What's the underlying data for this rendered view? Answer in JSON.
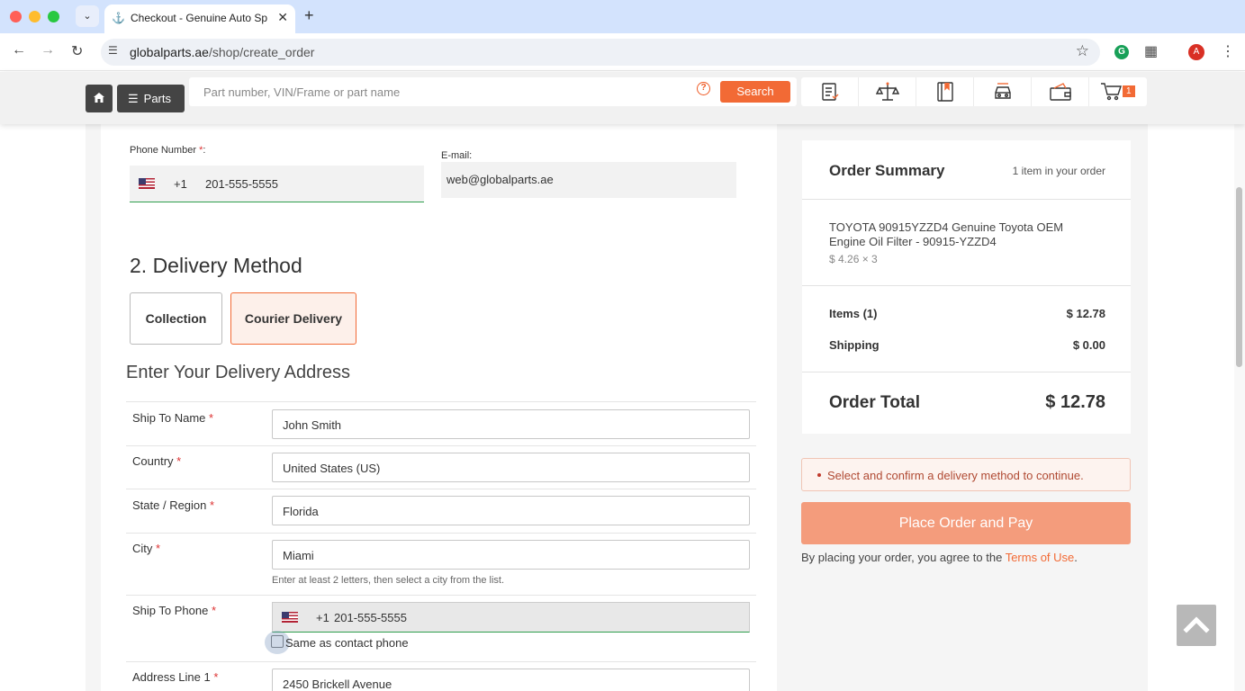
{
  "browser": {
    "tab_title": "Checkout - Genuine Auto Spa",
    "url_host": "globalparts.ae",
    "url_path": "/shop/create_order",
    "avatar_letter": "A"
  },
  "header": {
    "parts_label": "Parts",
    "search_placeholder": "Part number, VIN/Frame or part name",
    "search_button": "Search",
    "cart_count": "1"
  },
  "contact": {
    "phone_label": "Phone Number",
    "phone_code": "+1",
    "phone_value": "201-555-5555",
    "email_label": "E-mail:",
    "email_value": "web@globalparts.ae"
  },
  "delivery": {
    "title": "2. Delivery Method",
    "option_collection": "Collection",
    "option_courier": "Courier Delivery",
    "selected": "Courier Delivery"
  },
  "address": {
    "title": "Enter Your Delivery Address",
    "ship_name_label": "Ship To Name",
    "ship_name_value": "John Smith",
    "country_label": "Country",
    "country_value": "United States (US)",
    "state_label": "State / Region",
    "state_value": "Florida",
    "city_label": "City",
    "city_value": "Miami",
    "city_hint": "Enter at least 2 letters, then select a city from the list.",
    "ship_phone_label": "Ship To Phone",
    "ship_phone_code": "+1",
    "ship_phone_value": "201-555-5555",
    "same_as_contact": "Same as contact phone",
    "address1_label": "Address Line 1",
    "address1_value": "2450 Brickell Avenue"
  },
  "summary": {
    "title": "Order Summary",
    "count": "1 item in your order",
    "item_name": "TOYOTA 90915YZZD4 Genuine Toyota OEM Engine Oil Filter - 90915-YZZD4",
    "item_price": "$ 4.26 × 3",
    "items_label": "Items (1)",
    "items_value": "$ 12.78",
    "shipping_label": "Shipping",
    "shipping_value": "$ 0.00",
    "total_label": "Order Total",
    "total_value": "$ 12.78"
  },
  "checkout": {
    "alert": "Select and confirm a delivery method to continue.",
    "place_order": "Place Order and Pay",
    "terms_prefix": "By placing your order, you agree to the",
    "terms_link": "Terms of Use",
    "terms_suffix": "."
  },
  "colors": {
    "accent": "#f26a35",
    "place_button": "#f49c7c",
    "valid_border": "#2e9e4d"
  }
}
